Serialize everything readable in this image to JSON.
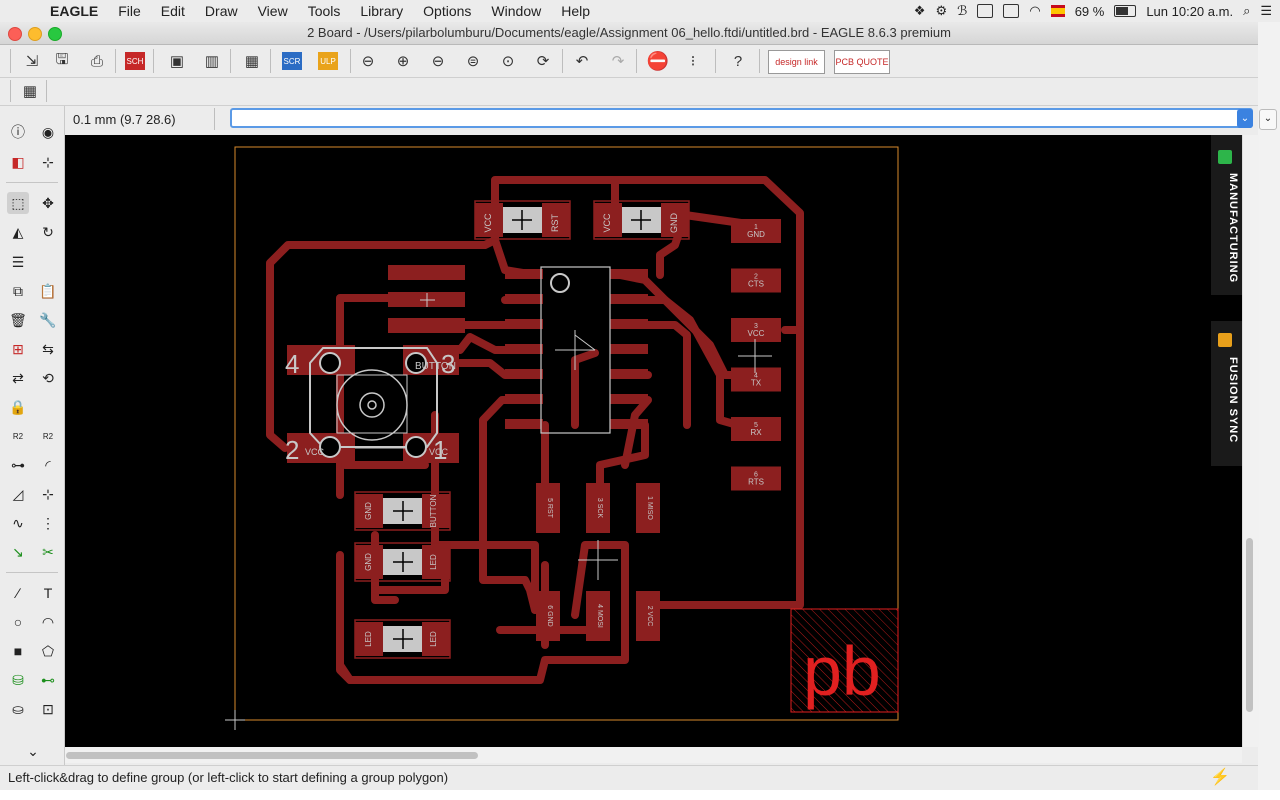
{
  "menubar": {
    "app": "EAGLE",
    "items": [
      "File",
      "Edit",
      "Draw",
      "View",
      "Tools",
      "Library",
      "Options",
      "Window",
      "Help"
    ],
    "battery": "69 %",
    "clock": "Lun 10:20 a.m."
  },
  "window": {
    "title": "2 Board - /Users/pilarbolumburu/Documents/eagle/Assignment 06_hello.ftdi/untitled.brd - EAGLE 8.6.3 premium"
  },
  "toolbar": {
    "designlink": "design link",
    "pcbquote": "PCB QUOTE"
  },
  "coordbar": {
    "coordinates": "0.1 mm (9.7 28.6)",
    "command_value": ""
  },
  "status": {
    "text": "Left-click&drag to define group (or left-click to start defining a group polygon)"
  },
  "right_panel": {
    "manufacturing": "MANUFACTURING",
    "fusion_sync": "FUSION SYNC"
  },
  "board": {
    "ftdi_pins": [
      {
        "num": "1",
        "name": "GND"
      },
      {
        "num": "2",
        "name": "CTS"
      },
      {
        "num": "3",
        "name": "VCC"
      },
      {
        "num": "4",
        "name": "TX"
      },
      {
        "num": "5",
        "name": "RX"
      },
      {
        "num": "6",
        "name": "RTS"
      }
    ],
    "isp_pins": [
      {
        "num": "5",
        "name": "RST"
      },
      {
        "num": "3",
        "name": "SCK"
      },
      {
        "num": "1",
        "name": "MISO"
      },
      {
        "num": "6",
        "name": "GND"
      },
      {
        "num": "4",
        "name": "MOSI"
      },
      {
        "num": "2",
        "name": "VCC"
      }
    ],
    "button_pins": [
      "4",
      "3",
      "2",
      "1"
    ],
    "button_label": "BUTTON",
    "vcc_label": "VCC",
    "cap_labels": [
      [
        "VCC",
        "RST"
      ],
      [
        "VCC",
        "GND"
      ]
    ],
    "res_labels": [
      [
        "GND",
        "BUTTON"
      ],
      [
        "GND",
        "LED"
      ],
      [
        "LED",
        "LED"
      ]
    ],
    "logo": "pb"
  },
  "colors": {
    "copper": "#8c1f1f",
    "silk": "#c8c8c8",
    "outline": "#d88a2d",
    "logo": "#e02020"
  }
}
